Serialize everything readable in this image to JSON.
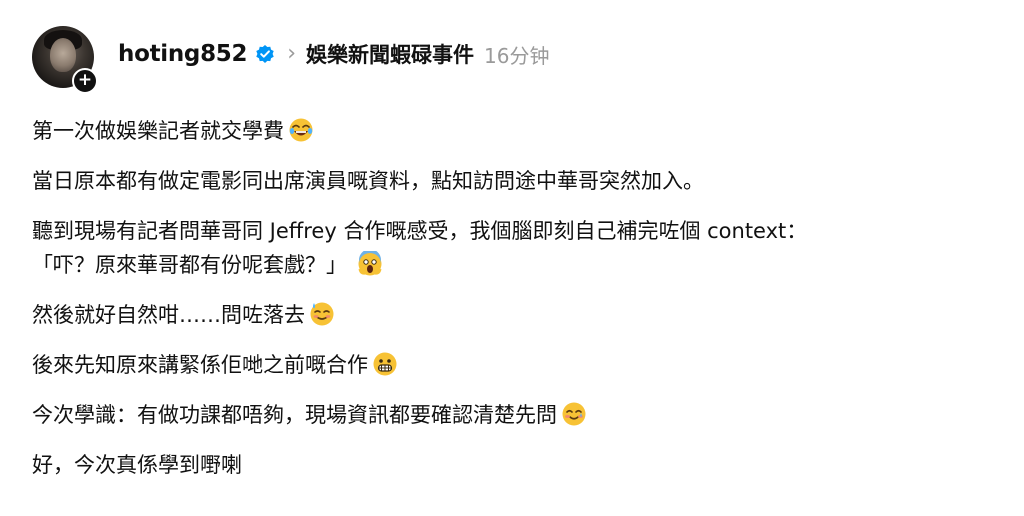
{
  "post": {
    "username": "hoting852",
    "topic": "娛樂新聞蝦碌事件",
    "timestamp": "16分钟",
    "follow_symbol": "+",
    "paragraphs": [
      {
        "text": "第一次做娛樂記者就交學費",
        "emoji": "rolling-on-floor-laughing-emoji"
      },
      {
        "text": "當日原本都有做定電影同出席演員嘅資料，點知訪問途中華哥突然加入。",
        "emoji": ""
      },
      {
        "text": "聽到現場有記者問華哥同 Jeffrey 合作嘅感受，我個腦即刻自己補完咗個 context：",
        "emoji": ""
      },
      {
        "text": "「吓？原來華哥都有份呢套戲？」",
        "emoji": "face-screaming-in-fear-emoji"
      },
      {
        "text": "然後就好自然咁……問咗落去",
        "emoji": "sweat-smile-emoji"
      },
      {
        "text": "後來先知原來講緊係佢哋之前嘅合作",
        "emoji": "grimacing-face-emoji"
      },
      {
        "text": "今次學識：有做功課都唔夠，現場資訊都要確認清楚先問",
        "emoji": "smiling-with-tear-emoji"
      },
      {
        "text": "好，今次真係學到嘢喇",
        "emoji": ""
      }
    ]
  },
  "colors": {
    "text": "#111111",
    "muted": "#9a9a9a",
    "verified": "#0095f6",
    "emoji_yellow": "#f7c235"
  }
}
